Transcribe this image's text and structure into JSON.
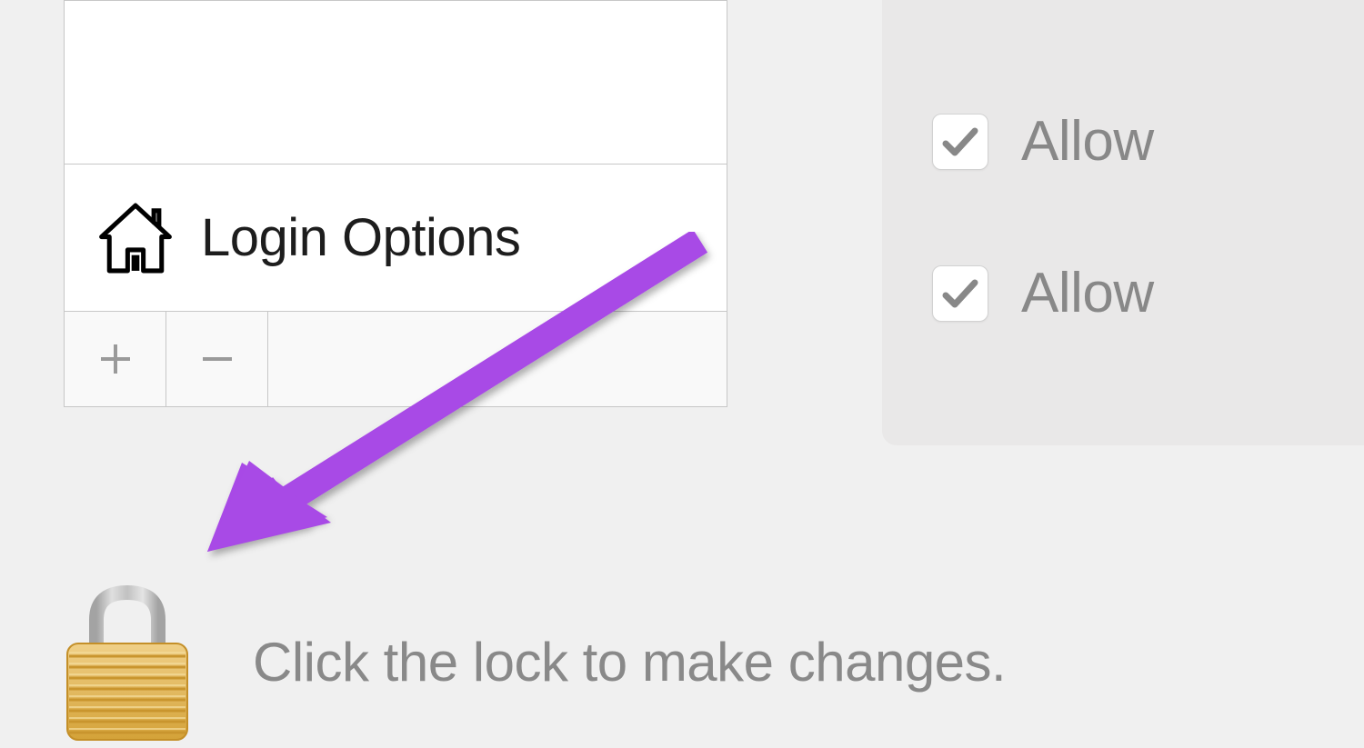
{
  "sidebar": {
    "login_options_label": "Login Options"
  },
  "options": {
    "item1_label": "Allow",
    "item1_checked": true,
    "item2_label": "Allow",
    "item2_checked": true
  },
  "lock": {
    "hint_text": "Click the lock to make changes."
  },
  "colors": {
    "annotation_arrow": "#a84ae6"
  }
}
